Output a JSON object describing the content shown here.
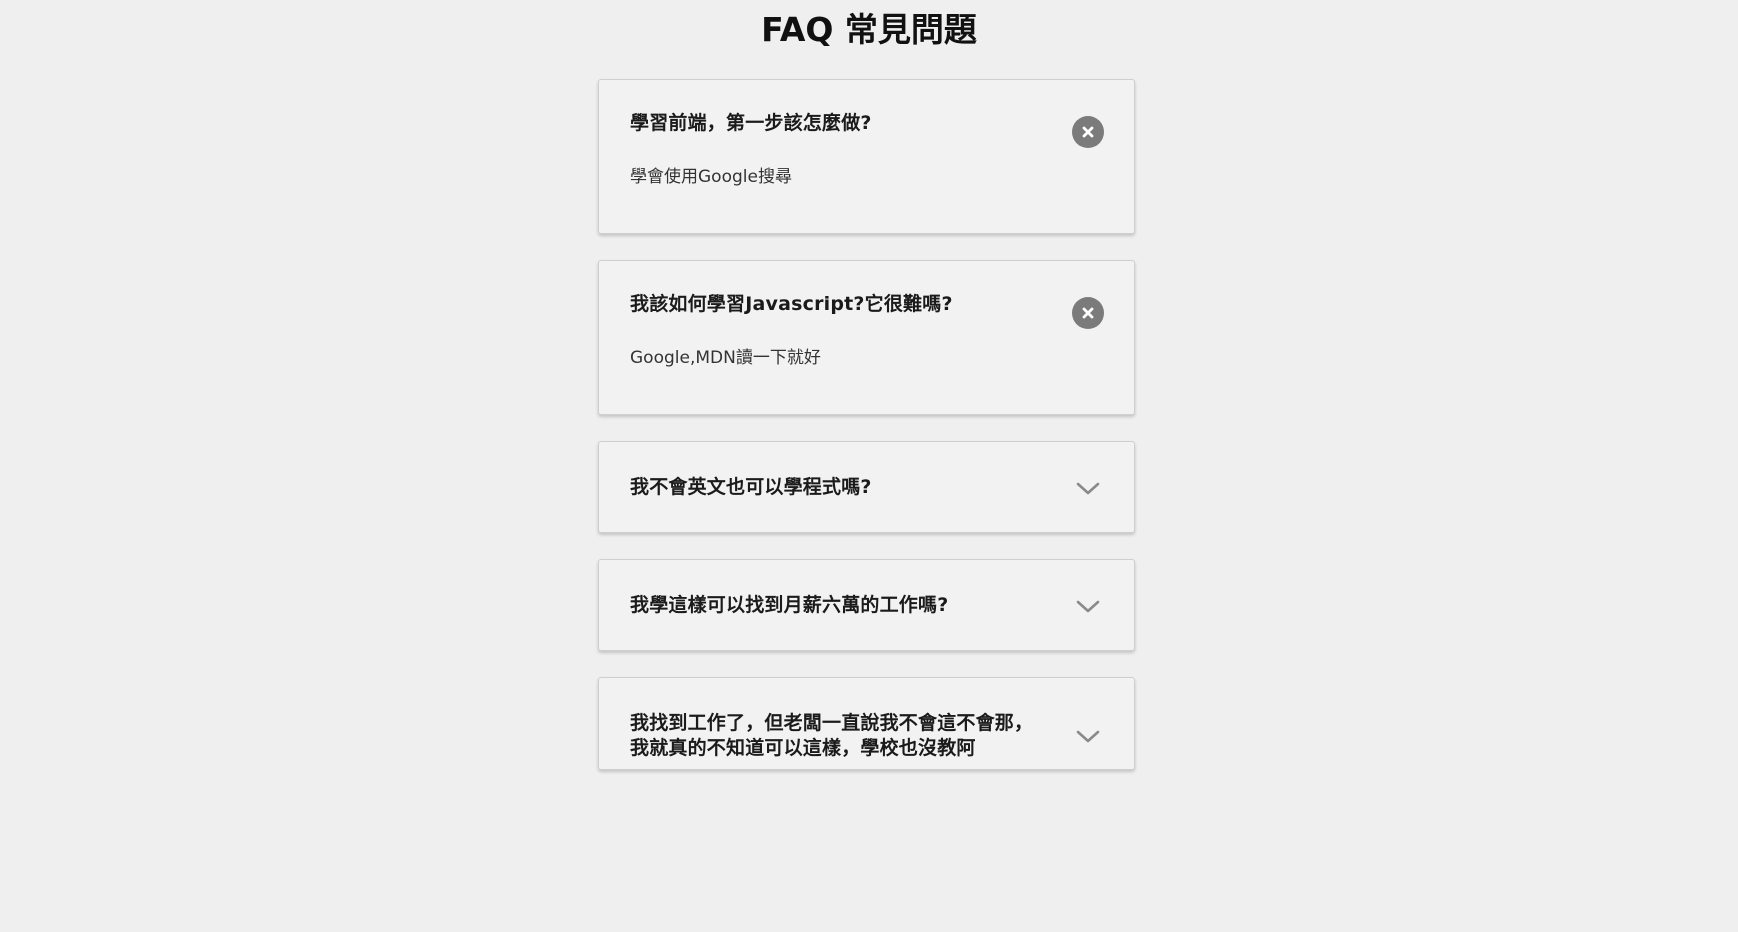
{
  "page": {
    "title": "FAQ 常見問題"
  },
  "faq": {
    "items": [
      {
        "question": "學習前端，第一步該怎麼做?",
        "answer": "學會使用Google搜尋",
        "expanded": true,
        "toggle_icon": "close-icon"
      },
      {
        "question": "我該如何學習Javascript?它很難嗎?",
        "answer": "Google,MDN讀一下就好",
        "expanded": true,
        "toggle_icon": "close-icon"
      },
      {
        "question": "我不會英文也可以學程式嗎?",
        "answer": "",
        "expanded": false,
        "toggle_icon": "chevron-down-icon"
      },
      {
        "question": "我學這樣可以找到月薪六萬的工作嗎?",
        "answer": "",
        "expanded": false,
        "toggle_icon": "chevron-down-icon"
      },
      {
        "question": "我找到工作了，但老闆一直說我不會這不會那，我就真的不知道可以這樣，學校也沒教阿",
        "answer": "",
        "expanded": false,
        "toggle_icon": "chevron-down-icon"
      }
    ]
  },
  "colors": {
    "background": "#efefef",
    "card": "#f2f2f2",
    "icon": "#7b7b7b"
  }
}
